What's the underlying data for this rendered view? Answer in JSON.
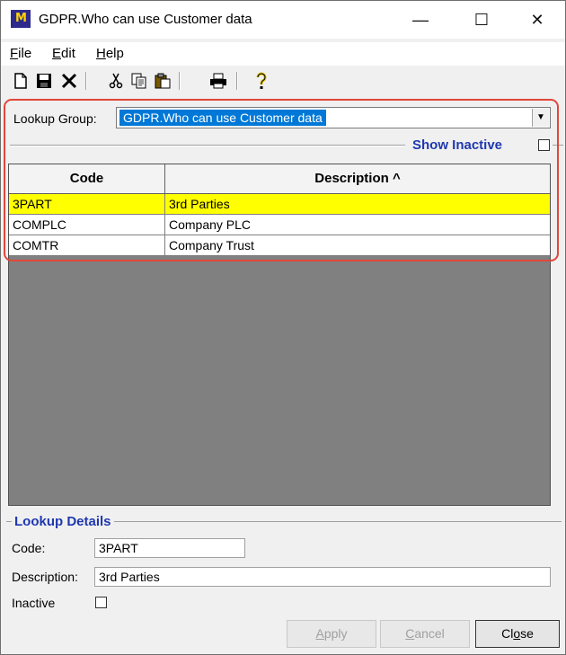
{
  "window": {
    "icon_label": "M",
    "title": "GDPR.Who can use Customer data",
    "controls": {
      "minimize": "—",
      "maximize": "☐",
      "close": "✕"
    }
  },
  "menu": [
    {
      "label": "File",
      "access_key": "F",
      "rest": "ile"
    },
    {
      "label": "Edit",
      "access_key": "E",
      "rest": "dit"
    },
    {
      "label": "Help",
      "access_key": "H",
      "rest": "elp"
    }
  ],
  "toolbar": {
    "new": "new-document-icon",
    "save": "save-icon",
    "delete": "delete-icon",
    "cut": "cut-icon",
    "copy": "copy-icon",
    "paste": "paste-icon",
    "print": "print-icon",
    "help": "help-icon"
  },
  "lookup_group": {
    "label": "Lookup Group:",
    "selected": "GDPR.Who can use Customer data"
  },
  "show_inactive": {
    "label": "Show Inactive",
    "checked": false
  },
  "grid": {
    "columns": [
      "Code",
      "Description ^"
    ],
    "rows": [
      {
        "code": "3PART",
        "description": "3rd Parties",
        "selected": true
      },
      {
        "code": "COMPLC",
        "description": "Company PLC",
        "selected": false
      },
      {
        "code": "COMTR",
        "description": "Company Trust",
        "selected": false
      }
    ]
  },
  "details": {
    "title": "Lookup Details",
    "code_label": "Code:",
    "code_value": "3PART",
    "description_label": "Description:",
    "description_value": "3rd Parties",
    "inactive_label": "Inactive",
    "inactive_checked": false
  },
  "buttons": {
    "apply": "Apply",
    "apply_key": "A",
    "apply_rest": "pply",
    "cancel": "Cancel",
    "cancel_key": "C",
    "cancel_rest": "ancel",
    "close_pre": "Cl",
    "close_key": "o",
    "close_rest": "se"
  },
  "colors": {
    "highlight": "#e0473a",
    "selected_row": "#ffff00",
    "accent_text": "#1f38b0",
    "selection_blue": "#0078d7"
  }
}
